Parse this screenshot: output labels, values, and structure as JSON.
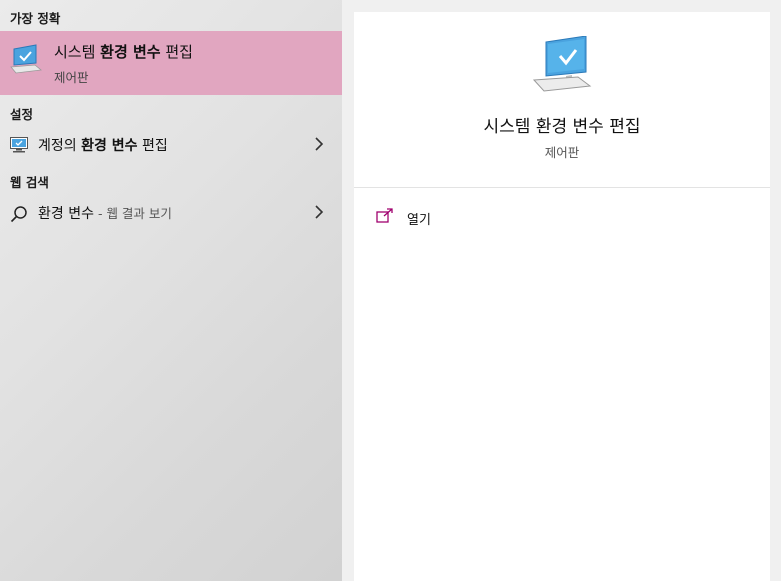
{
  "left": {
    "best_match_header": "가장 정확",
    "best_match": {
      "title_pre": "시스템 ",
      "title_bold": "환경 변수",
      "title_post": " 편집",
      "subtitle": "제어판",
      "icon": "computer-monitor-icon"
    },
    "settings_header": "설정",
    "settings_item": {
      "pre": "계정의 ",
      "bold": "환경 변수",
      "post": " 편집",
      "icon": "settings-monitor-icon"
    },
    "web_header": "웹 검색",
    "web_item": {
      "query": "환경 변수",
      "hint": " - 웹 결과 보기",
      "icon": "search-icon"
    }
  },
  "right": {
    "title": "시스템 환경 변수 편집",
    "subtitle": "제어판",
    "icon": "computer-monitor-icon",
    "actions": [
      {
        "label": "열기",
        "icon": "open-icon"
      }
    ]
  },
  "colors": {
    "highlight": "#e1a6c0",
    "accent": "#a0006e"
  }
}
